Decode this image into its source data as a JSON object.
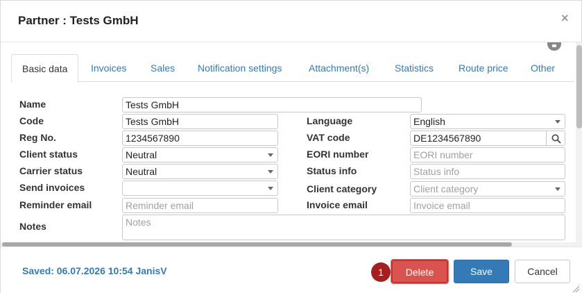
{
  "dialog": {
    "title": "Partner : Tests GmbH",
    "close_glyph": "×"
  },
  "tabs": [
    {
      "label": "Basic data",
      "active": true
    },
    {
      "label": "Invoices"
    },
    {
      "label": "Sales"
    },
    {
      "label": "Notification settings"
    },
    {
      "label": "Attachment(s)"
    },
    {
      "label": "Statistics"
    },
    {
      "label": "Route price"
    },
    {
      "label": "Other"
    }
  ],
  "form": {
    "name": {
      "label": "Name",
      "value": "Tests GmbH"
    },
    "code": {
      "label": "Code",
      "value": "Tests GmbH"
    },
    "reg_no": {
      "label": "Reg No.",
      "value": "1234567890"
    },
    "client_status": {
      "label": "Client status",
      "value": "Neutral"
    },
    "carrier_status": {
      "label": "Carrier status",
      "value": "Neutral"
    },
    "send_invoices": {
      "label": "Send invoices",
      "value": ""
    },
    "reminder_email": {
      "label": "Reminder email",
      "placeholder": "Reminder email"
    },
    "notes": {
      "label": "Notes",
      "placeholder": "Notes"
    },
    "language": {
      "label": "Language",
      "value": "English"
    },
    "vat_code": {
      "label": "VAT code",
      "value": "DE1234567890"
    },
    "eori_number": {
      "label": "EORI number",
      "placeholder": "EORI number"
    },
    "status_info": {
      "label": "Status info",
      "placeholder": "Status info"
    },
    "client_category": {
      "label": "Client category",
      "placeholder": "Client category"
    },
    "invoice_email": {
      "label": "Invoice email",
      "placeholder": "Invoice email"
    }
  },
  "footer": {
    "saved_text": "Saved: 06.07.2026 10:54 JanisV",
    "delete_label": "Delete",
    "save_label": "Save",
    "cancel_label": "Cancel",
    "step_badge": "1"
  },
  "colors": {
    "link_blue": "#337ab7",
    "danger_red": "#d9534f",
    "badge_red": "#a81d1d"
  }
}
